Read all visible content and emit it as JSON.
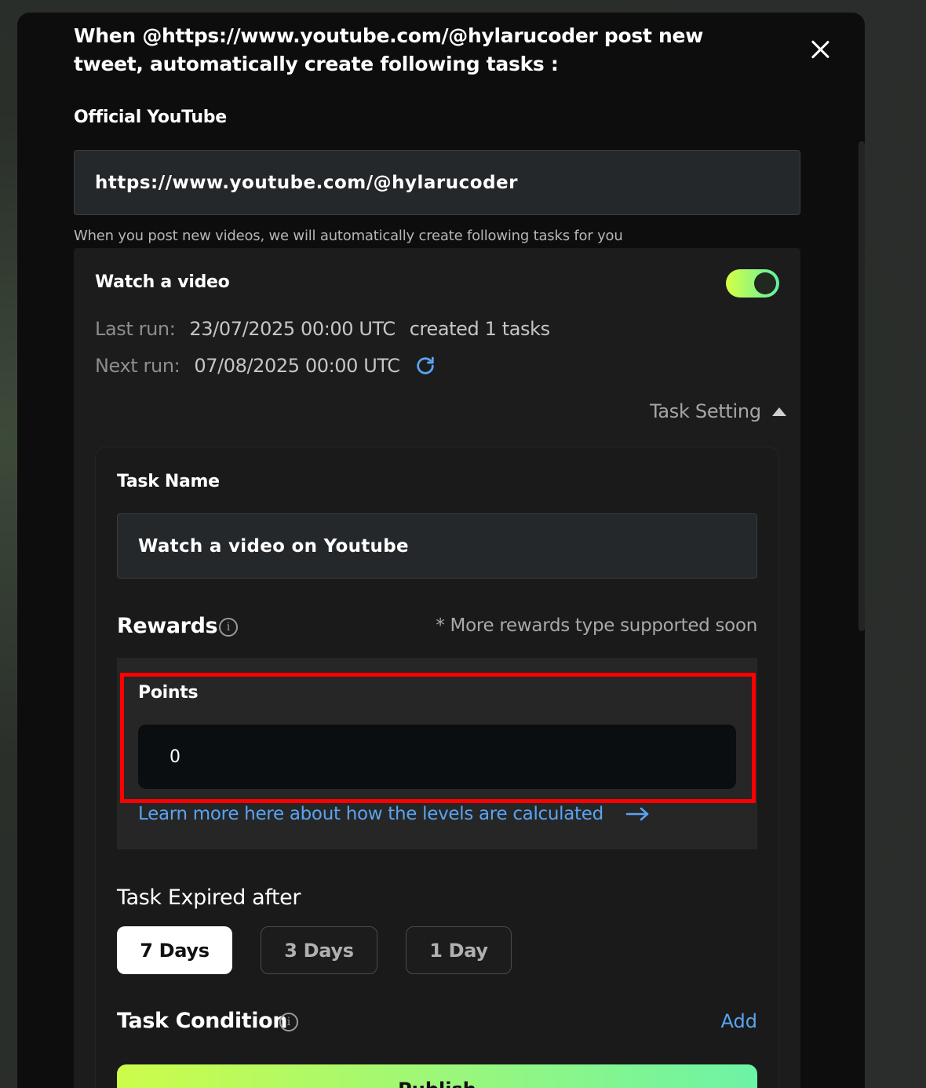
{
  "modal": {
    "heading": "When @https://www.youtube.com/@hylarucoder post new tweet, automatically create following tasks :",
    "official_label": "Official YouTube",
    "official_url": "https://www.youtube.com/@hylarucoder",
    "hint": "When you post new videos, we will automatically create following tasks for you"
  },
  "task": {
    "title": "Watch a video",
    "enabled": true,
    "last_run_label": "Last run:",
    "last_run_value": "23/07/2025 00:00 UTC",
    "created_text": "created 1 tasks",
    "next_run_label": "Next run:",
    "next_run_value": "07/08/2025 00:00 UTC",
    "setting_label": "Task Setting"
  },
  "settings": {
    "task_name_label": "Task Name",
    "task_name_value": "Watch a video on Youtube",
    "rewards_label": "Rewards",
    "rewards_note": "* More rewards type supported soon",
    "points_label": "Points",
    "points_value": "0",
    "learn_more": "Learn more here about how the levels are calculated",
    "expire_label": "Task Expired after",
    "expire_options": [
      "7 Days",
      "3 Days",
      "1 Day"
    ],
    "expire_selected": "7 Days",
    "condition_label": "Task Condition",
    "add_label": "Add",
    "publish_label": "Publish"
  },
  "colors": {
    "accent_link": "#5aa3f0",
    "highlight": "#ff0000",
    "toggle_gradient_start": "#d6ff45",
    "toggle_gradient_end": "#5ef0a2"
  }
}
